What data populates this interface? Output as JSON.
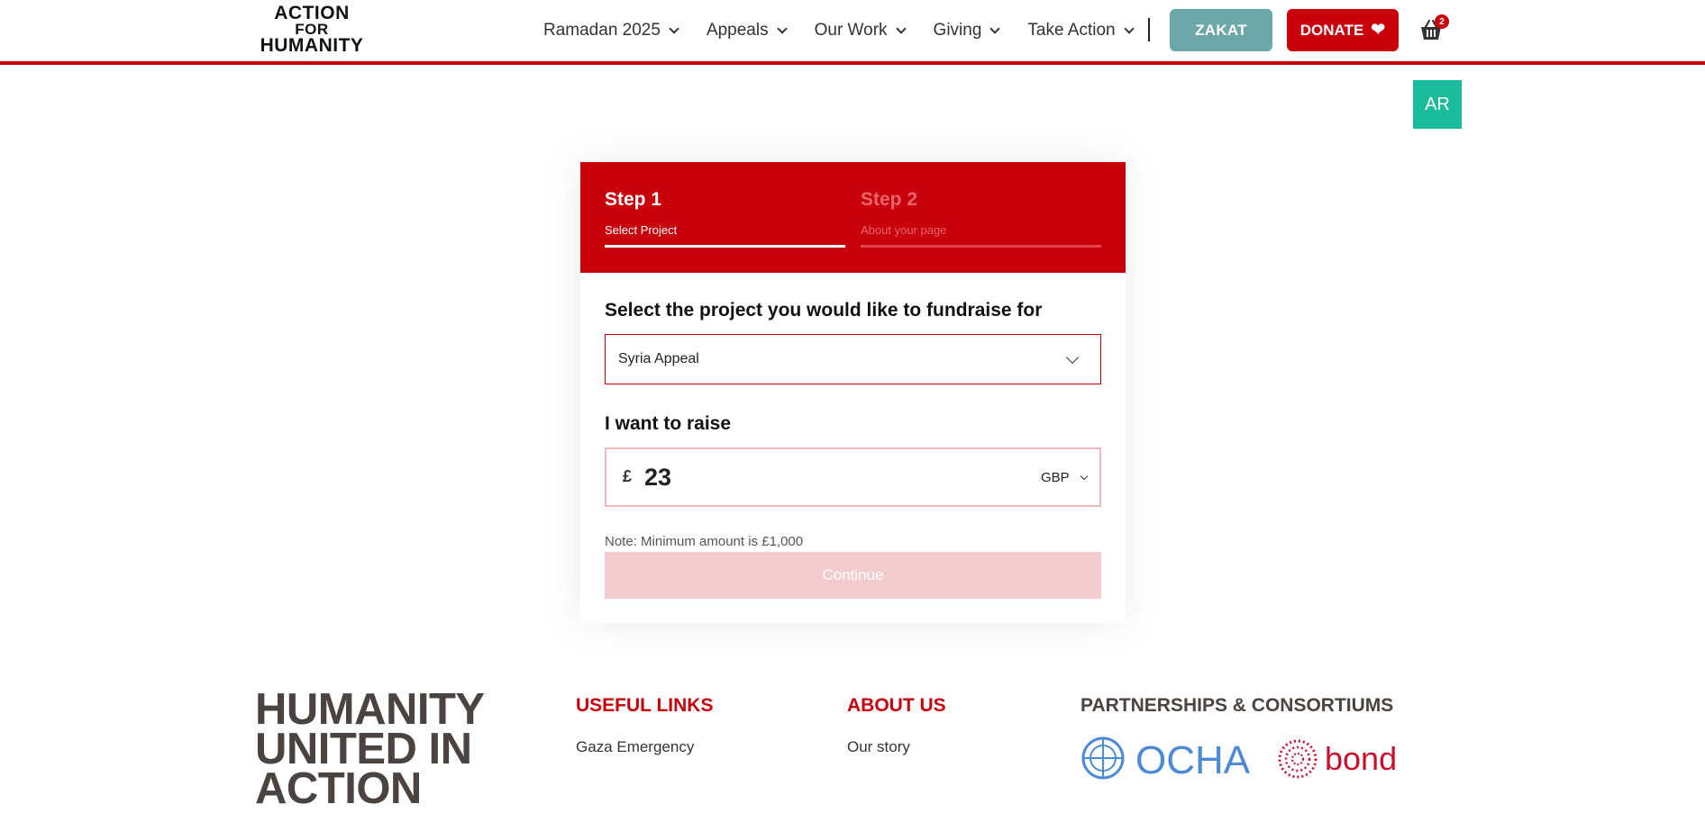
{
  "header": {
    "logo": {
      "line1": "ACTION",
      "line2": "FOR",
      "line3": "HUMANITY"
    },
    "nav": [
      {
        "label": "Ramadan 2025"
      },
      {
        "label": "Appeals"
      },
      {
        "label": "Our Work"
      },
      {
        "label": "Giving"
      },
      {
        "label": "Take Action"
      }
    ],
    "zakat_label": "ZAKAT",
    "donate_label": "DONATE",
    "cart_count": "2",
    "language_button": "AR"
  },
  "form": {
    "steps": [
      {
        "title": "Step 1",
        "subtitle": "Select Project",
        "active": true
      },
      {
        "title": "Step 2",
        "subtitle": "About your page",
        "active": false
      }
    ],
    "project_question": "Select the project you would like to fundraise for",
    "project_selected": "Syria Appeal",
    "raise_label": "I want to raise",
    "currency_symbol": "£",
    "amount_value": "23",
    "currency_code": "GBP",
    "note": "Note: Minimum amount is £1,000",
    "continue_label": "Continue"
  },
  "footer": {
    "tagline": "HUMANITY UNITED IN ACTION",
    "useful_links_title": "USEFUL LINKS",
    "useful_links": [
      "Gaza Emergency"
    ],
    "about_title": "ABOUT US",
    "about_links": [
      "Our story"
    ],
    "partnerships_title": "PARTNERSHIPS & CONSORTIUMS",
    "partners": [
      "OCHA",
      "bond"
    ]
  },
  "colors": {
    "brand_red": "#c8000b",
    "zakat_teal": "#6ca8a8",
    "ar_green": "#1abc9c",
    "continue_disabled": "#f3cbcc"
  }
}
